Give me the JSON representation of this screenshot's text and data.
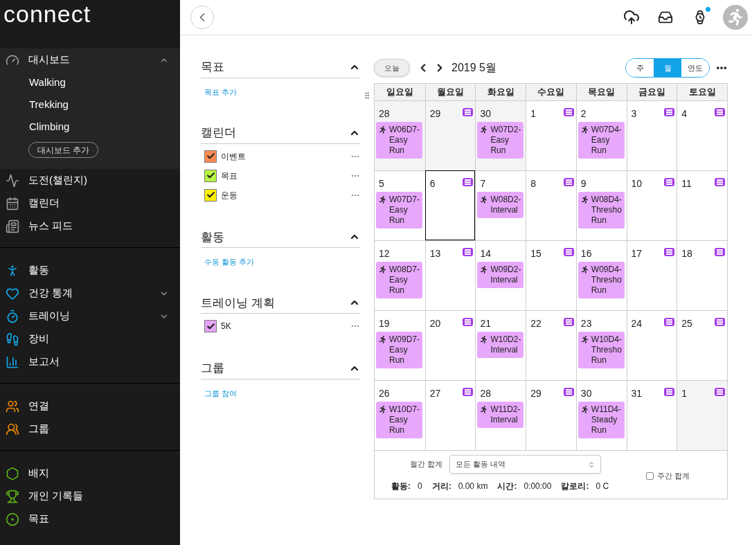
{
  "logo": "connect",
  "sidebar": {
    "sections": [
      {
        "color": "#9a9a9a",
        "items": [
          {
            "label": "대시보드",
            "expandable": true,
            "expanded": true,
            "children": [
              "Walking",
              "Trekking",
              "Climbing"
            ],
            "button": "대시보드 추가"
          },
          {
            "label": "도전(챌린지)",
            "expandable": false
          },
          {
            "label": "캘린더",
            "expandable": false
          },
          {
            "label": "뉴스 피드",
            "expandable": false
          }
        ]
      },
      {
        "color": "#11a9ed",
        "items": [
          {
            "label": "활동",
            "expandable": false
          },
          {
            "label": "건강 통계",
            "expandable": true,
            "expanded": false
          },
          {
            "label": "트레이닝",
            "expandable": true,
            "expanded": false
          },
          {
            "label": "장비",
            "expandable": false
          },
          {
            "label": "보고서",
            "expandable": false
          }
        ]
      },
      {
        "color": "#f08a00",
        "items": [
          {
            "label": "연결",
            "expandable": false
          },
          {
            "label": "그룹",
            "expandable": false
          }
        ]
      },
      {
        "color": "#5db118",
        "items": [
          {
            "label": "배지",
            "expandable": false
          },
          {
            "label": "개인 기록들",
            "expandable": false
          },
          {
            "label": "목표",
            "expandable": false
          }
        ]
      }
    ]
  },
  "topbar": {
    "device_notification": true
  },
  "filters": [
    {
      "title": "목표",
      "expanded": true,
      "link": "목표 추가"
    },
    {
      "title": "캘린더",
      "expanded": true,
      "items": [
        {
          "label": "이벤트",
          "checked": true,
          "color": "#ff8b53"
        },
        {
          "label": "목표",
          "checked": true,
          "color": "#b6f542"
        },
        {
          "label": "운동",
          "checked": true,
          "color": "#ffef00"
        }
      ]
    },
    {
      "title": "활동",
      "expanded": true,
      "link": "수동 활동 추가"
    },
    {
      "title": "트레이닝 계획",
      "expanded": true,
      "items": [
        {
          "label": "5K",
          "checked": true,
          "color": "#e6a4f7"
        }
      ]
    },
    {
      "title": "그룹",
      "expanded": true,
      "link": "그룹 참여"
    }
  ],
  "calendar": {
    "today_button": "오늘",
    "title": "2019 5월",
    "views": [
      {
        "label": "주",
        "selected": false
      },
      {
        "label": "월",
        "selected": true
      },
      {
        "label": "연도",
        "selected": false
      }
    ],
    "weekdays": [
      "일요일",
      "월요일",
      "화요일",
      "수요일",
      "목요일",
      "금요일",
      "토요일"
    ],
    "days": [
      {
        "day": "28",
        "muted": true,
        "selected": false,
        "note": false,
        "event": "W06D7- Easy Run"
      },
      {
        "day": "29",
        "muted": true,
        "selected": false,
        "note": true
      },
      {
        "day": "30",
        "muted": true,
        "selected": false,
        "note": false,
        "event": "W07D2- Easy Run"
      },
      {
        "day": "1",
        "muted": false,
        "selected": false,
        "note": true
      },
      {
        "day": "2",
        "muted": false,
        "selected": false,
        "note": false,
        "event": "W07D4- Easy Run"
      },
      {
        "day": "3",
        "muted": false,
        "selected": false,
        "note": true
      },
      {
        "day": "4",
        "muted": false,
        "selected": false,
        "note": true
      },
      {
        "day": "5",
        "muted": false,
        "selected": false,
        "note": false,
        "event": "W07D7- Easy Run"
      },
      {
        "day": "6",
        "muted": false,
        "selected": true,
        "note": true
      },
      {
        "day": "7",
        "muted": false,
        "selected": false,
        "note": false,
        "event": "W08D2- Interval"
      },
      {
        "day": "8",
        "muted": false,
        "selected": false,
        "note": true
      },
      {
        "day": "9",
        "muted": false,
        "selected": false,
        "note": false,
        "event": "W08D4- Thresho Run"
      },
      {
        "day": "10",
        "muted": false,
        "selected": false,
        "note": true
      },
      {
        "day": "11",
        "muted": false,
        "selected": false,
        "note": true
      },
      {
        "day": "12",
        "muted": false,
        "selected": false,
        "note": false,
        "event": "W08D7- Easy Run"
      },
      {
        "day": "13",
        "muted": false,
        "selected": false,
        "note": true
      },
      {
        "day": "14",
        "muted": false,
        "selected": false,
        "note": false,
        "event": "W09D2- Interval"
      },
      {
        "day": "15",
        "muted": false,
        "selected": false,
        "note": true
      },
      {
        "day": "16",
        "muted": false,
        "selected": false,
        "note": false,
        "event": "W09D4- Thresho Run"
      },
      {
        "day": "17",
        "muted": false,
        "selected": false,
        "note": true
      },
      {
        "day": "18",
        "muted": false,
        "selected": false,
        "note": true
      },
      {
        "day": "19",
        "muted": false,
        "selected": false,
        "note": false,
        "event": "W09D7- Easy Run"
      },
      {
        "day": "20",
        "muted": false,
        "selected": false,
        "note": true
      },
      {
        "day": "21",
        "muted": false,
        "selected": false,
        "note": false,
        "event": "W10D2- Interval"
      },
      {
        "day": "22",
        "muted": false,
        "selected": false,
        "note": true
      },
      {
        "day": "23",
        "muted": false,
        "selected": false,
        "note": false,
        "event": "W10D4- Thresho Run"
      },
      {
        "day": "24",
        "muted": false,
        "selected": false,
        "note": true
      },
      {
        "day": "25",
        "muted": false,
        "selected": false,
        "note": true
      },
      {
        "day": "26",
        "muted": false,
        "selected": false,
        "note": false,
        "event": "W10D7- Easy Run"
      },
      {
        "day": "27",
        "muted": false,
        "selected": false,
        "note": true
      },
      {
        "day": "28",
        "muted": false,
        "selected": false,
        "note": false,
        "event": "W11D2- Interval"
      },
      {
        "day": "29",
        "muted": false,
        "selected": false,
        "note": true
      },
      {
        "day": "30",
        "muted": false,
        "selected": false,
        "note": false,
        "event": "W11D4- Steady Run"
      },
      {
        "day": "31",
        "muted": false,
        "selected": false,
        "note": true
      },
      {
        "day": "1",
        "muted": true,
        "selected": false,
        "note": true
      }
    ],
    "footer": {
      "total_label": "월간 합계",
      "select_value": "모든 활동 내역",
      "weekly_total": {
        "label": "주간 합계",
        "checked": false
      },
      "stats": [
        {
          "label": "활동:",
          "value": "0"
        },
        {
          "label": "거리:",
          "value": "0.00 km"
        },
        {
          "label": "시간:",
          "value": "0:00:00"
        },
        {
          "label": "칼로리:",
          "value": "0 C"
        }
      ]
    }
  }
}
